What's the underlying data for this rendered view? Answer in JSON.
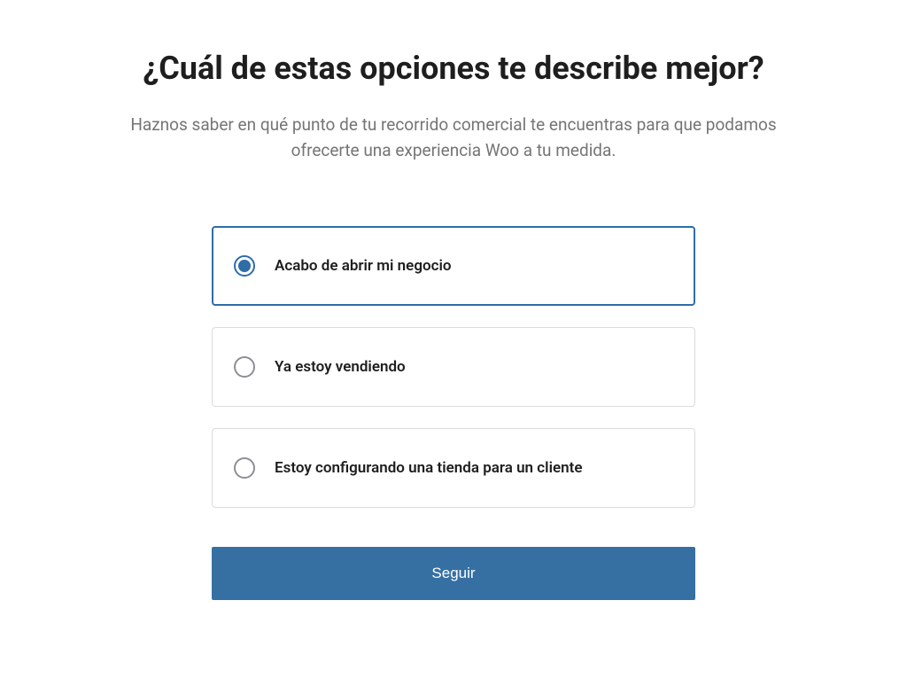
{
  "title": "¿Cuál de estas opciones te describe mejor?",
  "subtitle": "Haznos saber en qué punto de tu recorrido comercial te encuentras para que podamos ofrecerte una experiencia Woo a tu medida.",
  "options": [
    {
      "label": "Acabo de abrir mi negocio",
      "selected": true
    },
    {
      "label": "Ya estoy vendiendo",
      "selected": false
    },
    {
      "label": "Estoy configurando una tienda para un cliente",
      "selected": false
    }
  ],
  "continue_label": "Seguir"
}
